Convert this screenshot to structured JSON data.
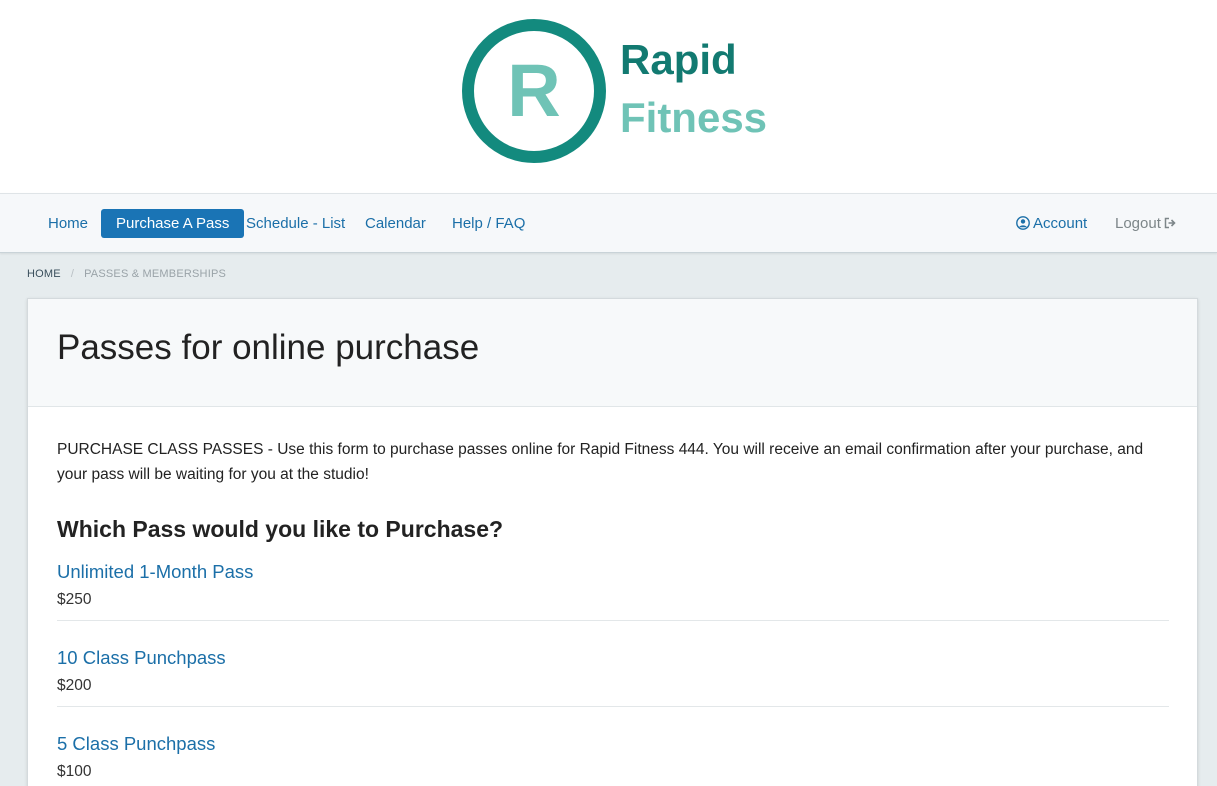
{
  "brand": {
    "logo_letter": "R",
    "logo_word1": "Rapid",
    "logo_word2": "Fitness",
    "ring_color": "#138a7e",
    "light_color": "#6fc3b6"
  },
  "nav": {
    "home": "Home",
    "purchase": "Purchase A Pass",
    "schedule": "Schedule - List",
    "calendar": "Calendar",
    "help": "Help / FAQ",
    "account": "Account",
    "logout": "Logout",
    "account_icon": "user-circle-icon",
    "logout_icon": "sign-out-icon",
    "active_color": "#1a74b5"
  },
  "breadcrumb": {
    "home": "HOME",
    "separator": "/",
    "current": "PASSES & MEMBERSHIPS"
  },
  "page": {
    "title": "Passes for online purchase",
    "intro": "PURCHASE CLASS PASSES - Use this form to purchase passes online for Rapid Fitness 444. You will receive an email confirmation after your purchase, and your pass will be waiting for you at the studio!",
    "question": "Which Pass would you like to Purchase?"
  },
  "passes": [
    {
      "name": "Unlimited 1-Month Pass",
      "price": "$250"
    },
    {
      "name": "10 Class Punchpass",
      "price": "$200"
    },
    {
      "name": "5 Class Punchpass",
      "price": "$100"
    }
  ]
}
